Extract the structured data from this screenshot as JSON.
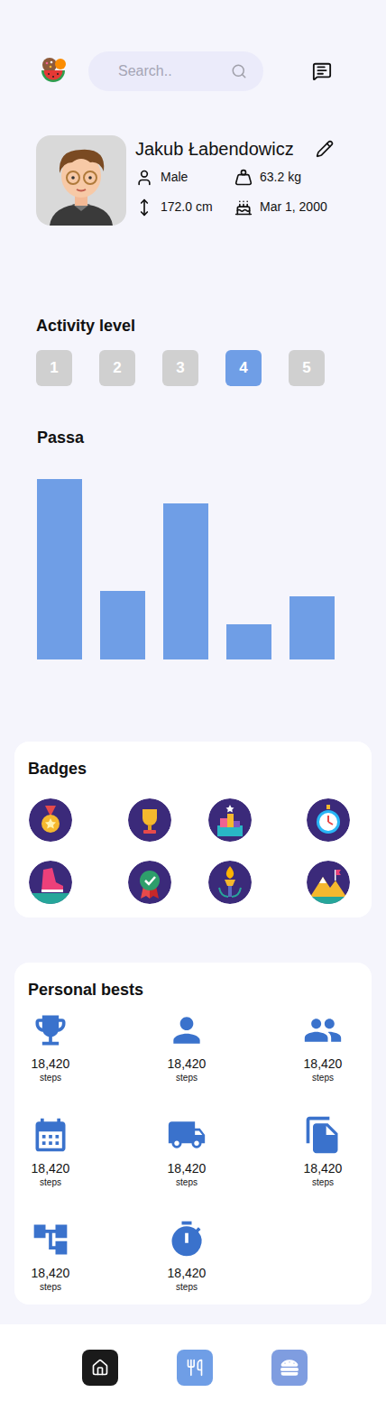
{
  "header": {
    "search": {
      "placeholder": "Search.."
    }
  },
  "profile": {
    "name": "Jakub Łabendowicz",
    "gender": "Male",
    "weight": "63.2 kg",
    "height": "172.0 cm",
    "birthday": "Mar 1, 2000"
  },
  "activity_level": {
    "title": "Activity level",
    "levels": [
      {
        "label": "1",
        "selected": false
      },
      {
        "label": "2",
        "selected": false
      },
      {
        "label": "3",
        "selected": false
      },
      {
        "label": "4",
        "selected": true
      },
      {
        "label": "5",
        "selected": false
      }
    ]
  },
  "chart": {
    "title": "Passa",
    "values": [
      199,
      76,
      172,
      39,
      70
    ]
  },
  "badges": {
    "title": "Badges",
    "items": [
      {
        "kind": "medal"
      },
      {
        "kind": "trophy"
      },
      {
        "kind": "podium"
      },
      {
        "kind": "stopwatch"
      },
      {
        "kind": "shoe"
      },
      {
        "kind": "ribbon"
      },
      {
        "kind": "torch"
      },
      {
        "kind": "mountain"
      }
    ]
  },
  "personal_bests": {
    "title": "Personal bests",
    "items": [
      {
        "kind": "trophy",
        "value": "18,420",
        "unit": "steps"
      },
      {
        "kind": "person",
        "value": "18,420",
        "unit": "steps"
      },
      {
        "kind": "people",
        "value": "18,420",
        "unit": "steps"
      },
      {
        "kind": "calendar",
        "value": "18,420",
        "unit": "steps"
      },
      {
        "kind": "truck",
        "value": "18,420",
        "unit": "steps"
      },
      {
        "kind": "files",
        "value": "18,420",
        "unit": "steps"
      },
      {
        "kind": "network",
        "value": "18,420",
        "unit": "steps"
      },
      {
        "kind": "timer",
        "value": "18,420",
        "unit": "steps"
      }
    ]
  },
  "nav": {
    "items": [
      {
        "kind": "home",
        "selected": true
      },
      {
        "kind": "food",
        "selected": false
      },
      {
        "kind": "burger",
        "selected": false
      }
    ]
  }
}
